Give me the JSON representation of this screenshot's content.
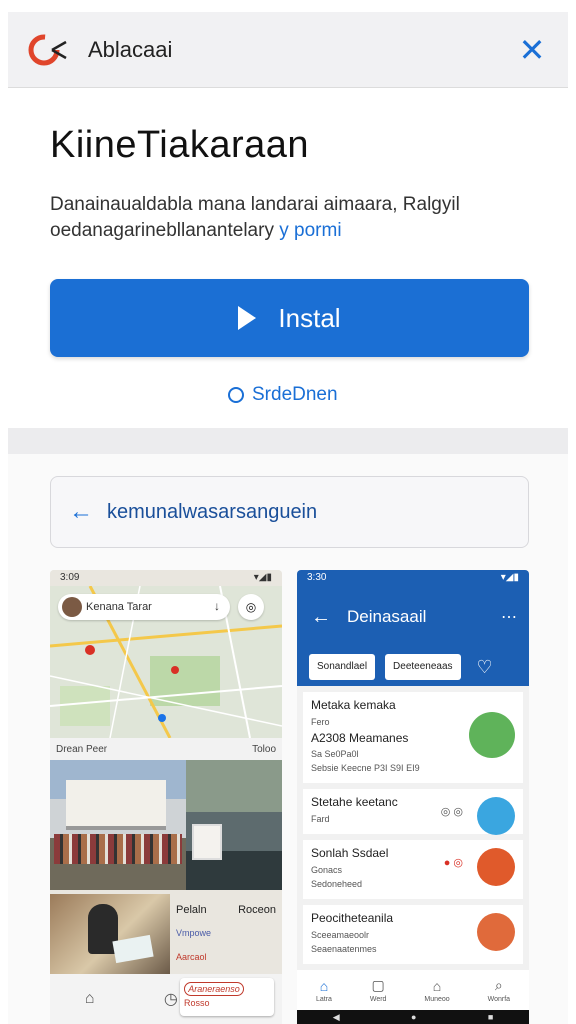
{
  "topbar": {
    "app_name": "Ablacaai",
    "close_icon": "close-icon"
  },
  "hero": {
    "title": "KiineTiakaraan",
    "description": "Danainaualdabla mana landarai aimaara, Ralgyil oedanagarinebllanantelary",
    "description_link": "y pormi",
    "install_label": "Instal",
    "secondary_label": "SrdeDnen"
  },
  "gallery": {
    "breadcrumb": "kemunalwasarsanguein",
    "left": {
      "status_time": "3:09",
      "search_text": "Kenana Tarar",
      "place_left": "Drean Peer",
      "place_right": "Toloo",
      "side_labels": [
        "Pelaln",
        "Roceon"
      ],
      "mini1": "Vmpowe",
      "mini2": "Aarcaol",
      "promo_text": "Araneraenso",
      "promo_sub": "Rosso"
    },
    "right": {
      "status_time": "3:30",
      "header": "Deinasaail",
      "chip1": "Sonandlael",
      "chip2": "Deeteeneaas",
      "card1": {
        "title": "Metaka kemaka",
        "sub": "Fero",
        "big": "A2308 Meamanes",
        "line1": "Sa Se0Pa0l",
        "line2": "Sebsie Keecne P3I S9I EI9"
      },
      "card2": {
        "title": "Stetahe keetanc",
        "sub": "Fard"
      },
      "card3": {
        "title": "Sonlah Ssdael",
        "sub": "Gonacs",
        "line": "Sedoneheed"
      },
      "card4": {
        "title": "Peocitheteanila",
        "sub": "Sceeamaeoolr",
        "line": "Seaenaatenmes"
      },
      "tabs": [
        "Latra",
        "Werd",
        "Muneoo",
        "Wonrfa"
      ]
    }
  },
  "colors": {
    "accent": "#1b6fd4",
    "header_blue": "#1c5fb3"
  }
}
